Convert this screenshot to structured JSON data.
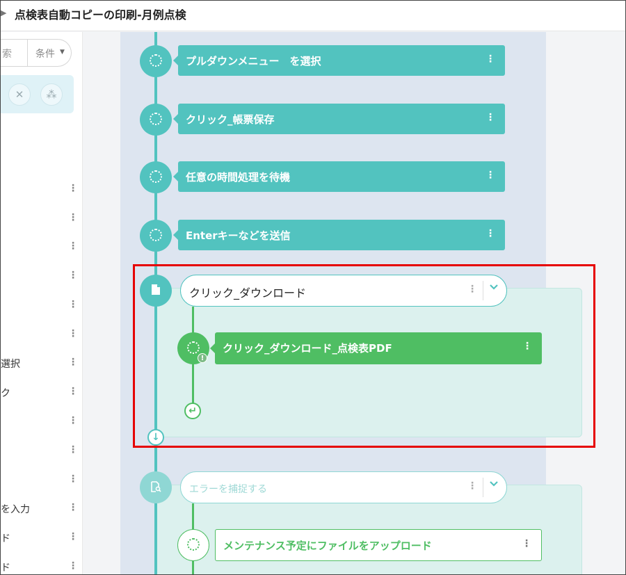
{
  "window": {
    "title": "点検表自動コピーの印刷-月例点検",
    "title_arrow": "▶"
  },
  "sidebar": {
    "search_placeholder": "索",
    "condition_label": "条件",
    "condition_caret": "▼",
    "tools": [
      {
        "icon": "tools-icon",
        "glyph": "✕"
      },
      {
        "icon": "cubes-icon",
        "glyph": "⁂"
      }
    ],
    "items": [
      {
        "label": "",
        "menu": "⋮"
      },
      {
        "label": "",
        "menu": "⋮"
      },
      {
        "label": "",
        "menu": "⋮"
      },
      {
        "label": "",
        "menu": "⋮"
      },
      {
        "label": "",
        "menu": "⋮"
      },
      {
        "label": "",
        "menu": "⋮"
      },
      {
        "label": "選択",
        "menu": "⋮"
      },
      {
        "label": "ク",
        "menu": "⋮"
      },
      {
        "label": "",
        "menu": "⋮"
      },
      {
        "label": "",
        "menu": "⋮"
      },
      {
        "label": "",
        "menu": "⋮"
      },
      {
        "label": "を入力",
        "menu": "⋮"
      },
      {
        "label": "ド",
        "menu": "⋮"
      },
      {
        "label": "ド",
        "menu": "⋮"
      }
    ]
  },
  "flow": {
    "steps": [
      {
        "label": "プルダウンメニュー　を選択",
        "menu": "⋮"
      },
      {
        "label": "クリック_帳票保存",
        "menu": "⋮"
      },
      {
        "label": "任意の時間処理を待機",
        "menu": "⋮"
      },
      {
        "label": "Enterキーなどを送信",
        "menu": "⋮"
      }
    ],
    "group1": {
      "header": "クリック_ダウンロード",
      "menu": "⋮",
      "chevron": "⌄",
      "icon": "document-icon",
      "child": {
        "label": "クリック_ダウンロード_点検表PDF",
        "menu": "⋮",
        "badge": "!"
      },
      "return_glyph": "↵",
      "down_glyph": "↓"
    },
    "group2": {
      "header": "エラーを捕捉する",
      "menu": "⋮",
      "chevron": "⌄",
      "icon": "error-search-icon",
      "child": {
        "label": "メンテナンス予定にファイルをアップロード",
        "menu": "⋮"
      }
    }
  },
  "colors": {
    "teal": "#52c3bf",
    "green": "#4fbe63",
    "highlight": "#e60000"
  }
}
